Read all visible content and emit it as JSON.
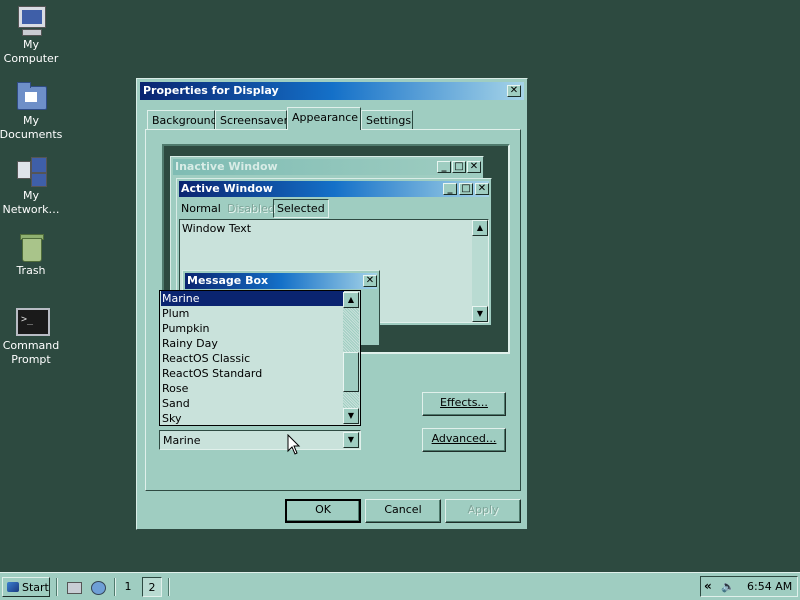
{
  "desktop": {
    "icons": [
      {
        "label": "My Computer",
        "icon": "computer-icon"
      },
      {
        "label": "My Documents",
        "icon": "documents-folder-icon"
      },
      {
        "label": "My Network…",
        "icon": "network-icon"
      },
      {
        "label": "Trash",
        "icon": "trash-icon"
      },
      {
        "label": "Command Prompt",
        "icon": "command-prompt-icon"
      }
    ]
  },
  "dialog": {
    "title": "Properties for Display",
    "close_glyph": "✕",
    "tabs": [
      "Background",
      "Screensaver",
      "Appearance",
      "Settings"
    ],
    "active_tab": "Appearance",
    "preview": {
      "inactive_title": "Inactive Window",
      "active_title": "Active Window",
      "menu": {
        "normal": "Normal",
        "disabled": "Disabled",
        "selected": "Selected"
      },
      "window_text": "Window Text",
      "message_box_title": "Message Box"
    },
    "scheme_list": {
      "items": [
        "Marine",
        "Plum",
        "Pumpkin",
        "Rainy Day",
        "ReactOS Classic",
        "ReactOS Standard",
        "Rose",
        "Sand",
        "Sky"
      ],
      "highlighted": "Marine"
    },
    "scheme_combo_value": "Marine",
    "buttons": {
      "effects": "Effects...",
      "advanced": "Advanced...",
      "ok": "OK",
      "cancel": "Cancel",
      "apply": "Apply"
    }
  },
  "taskbar": {
    "start_label": "Start",
    "workspaces": [
      "1",
      "2"
    ],
    "active_workspace": "2",
    "tray_chevron": "«",
    "clock": "6:54 AM"
  },
  "colors": {
    "desktop": "#2d4a40",
    "face": "#9fcdc1",
    "title_active_start": "#0a2470",
    "highlight": "#0a2470"
  }
}
